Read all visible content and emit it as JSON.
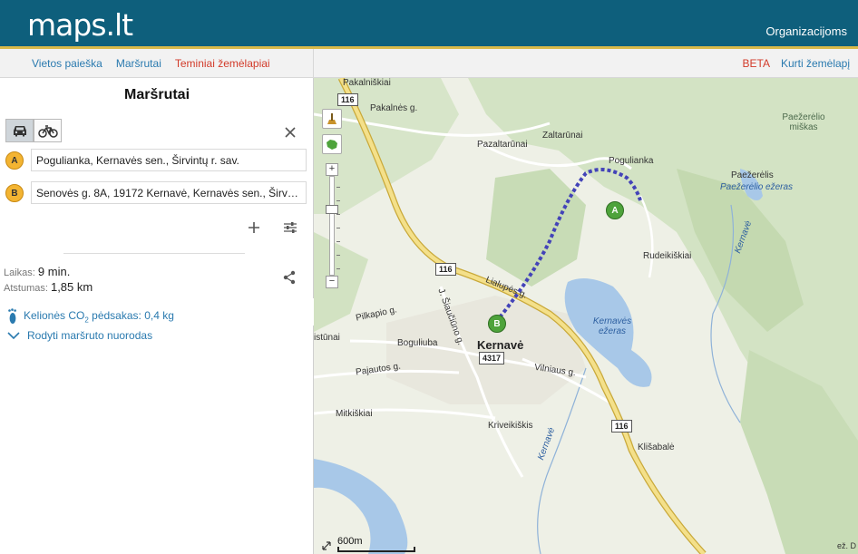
{
  "header": {
    "logo": "maps.lt",
    "org_link": "Organizacijoms"
  },
  "nav": {
    "left": [
      "Vietos paieška",
      "Maršrutai",
      "Teminiai žemėlapiai"
    ],
    "beta": "BETA",
    "create": "Kurti žemėlapį"
  },
  "panel": {
    "title": "Maršrutai",
    "modes": [
      "car-icon",
      "bicycle-icon"
    ],
    "point_a": {
      "marker": "A",
      "value": "Pogulianka, Kernavės sen., Širvintų r. sav."
    },
    "point_b": {
      "marker": "B",
      "value": "Senovės g. 8A, 19172 Kernavė, Kernavės sen., Širv…"
    },
    "time_label": "Laikas:",
    "time_value": "9 min.",
    "distance_label": "Atstumas:",
    "distance_value": "1,85 km",
    "co2_prefix": "Kelionės CO",
    "co2_sub": "2",
    "co2_suffix": " pėdsakas: 0,4 kg",
    "directions": "Rodyti maršruto nuorodas"
  },
  "map": {
    "labels": {
      "pakalniskiai": "Pakalniškiai",
      "pakalnes": "Pakalnės g.",
      "pazaltarunai": "Pazaltarūnai",
      "zaltarunai": "Zaltarūnai",
      "pogulianka": "Pogulianka",
      "paezerelio_miskas": "Paežerėlio miškas",
      "paezerelis": "Paežerėlis",
      "paezerelio_ezeras": "Paežerėlio ežeras",
      "kernave_river_1": "Kernavė",
      "rudeikiskiai": "Rudeikiškiai",
      "lialupes": "Lialupės g.",
      "j_siaucinno": "J. Šiaučiūno g.",
      "pilkapio": "Pilkapio g.",
      "istunai": "istūnai",
      "boguliuba": "Boguliuba",
      "kernave_town": "Kernavė",
      "kernaves_ezeras": "Kernavės ežeras",
      "pajautos": "Pajautos g.",
      "vilniaus": "Vilniaus g.",
      "mitkiskiai": "Mitkiškiai",
      "kriveikiskis": "Kriveikiškis",
      "kernave_river_2": "Kernavė",
      "klisabale": "Klišabalė"
    },
    "roads": {
      "r116a": "116",
      "r116b": "116",
      "r116c": "116",
      "r4317": "4317"
    },
    "pins": {
      "a": "A",
      "b": "B"
    },
    "zoom_in": "+",
    "zoom_out": "−",
    "scale": "600m",
    "attribution": "ež. D",
    "colors": {
      "route": "#4343b8",
      "road": "#f4e08a",
      "water": "#a8c8e8",
      "forest": "#cfe0c0"
    }
  }
}
